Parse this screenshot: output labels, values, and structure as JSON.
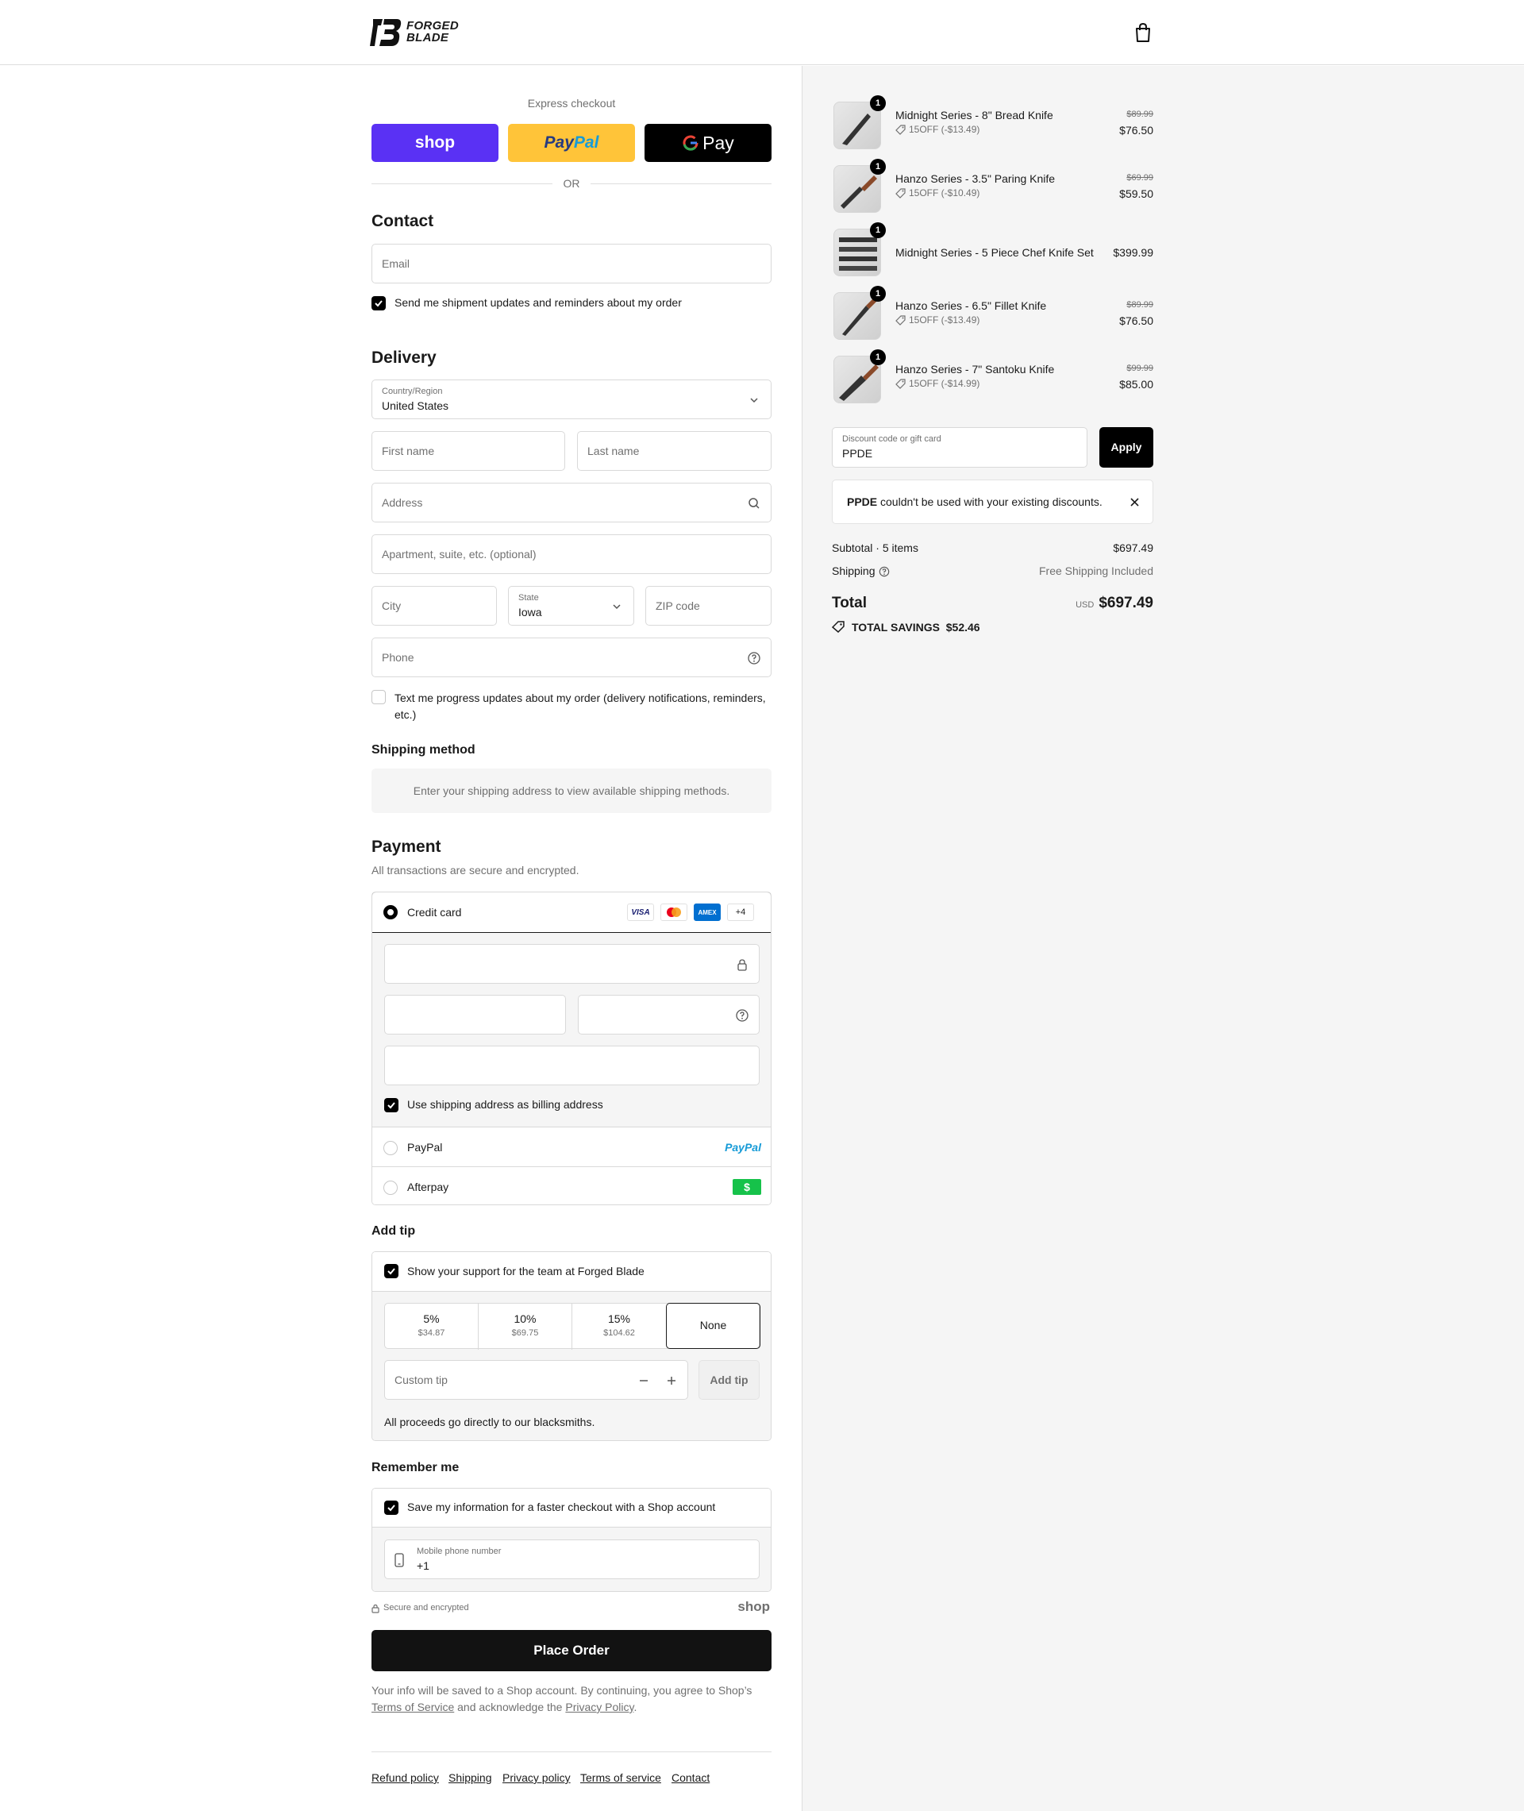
{
  "brand": {
    "line1": "FORGED",
    "line2": "BLADE"
  },
  "express": {
    "title": "Express checkout",
    "shop": "shop",
    "paypal_a": "Pay",
    "paypal_b": "Pal",
    "gpay": "Pay",
    "or": "OR"
  },
  "contact": {
    "title": "Contact",
    "email_placeholder": "Email",
    "updates_label": "Send me shipment updates and reminders about my order"
  },
  "delivery": {
    "title": "Delivery",
    "country_label": "Country/Region",
    "country_value": "United States",
    "first_name": "First name",
    "last_name": "Last name",
    "address": "Address",
    "apartment": "Apartment, suite, etc. (optional)",
    "city": "City",
    "state_label": "State",
    "state_value": "Iowa",
    "zip": "ZIP code",
    "phone": "Phone",
    "sms_label": "Text me progress updates about my order (delivery notifications, reminders, etc.)"
  },
  "shipping_method": {
    "title": "Shipping method",
    "notice": "Enter your shipping address to view available shipping methods."
  },
  "payment": {
    "title": "Payment",
    "subtitle": "All transactions are secure and encrypted.",
    "credit_card": "Credit card",
    "badges": {
      "visa": "VISA",
      "amex": "AMEX",
      "more": "+4"
    },
    "billing_label": "Use shipping address as billing address",
    "paypal": "PayPal",
    "paypal_logo": "PayPal",
    "afterpay": "Afterpay"
  },
  "tip": {
    "title": "Add tip",
    "support_label": "Show your support for the team at Forged Blade",
    "options": [
      {
        "pct": "5%",
        "amt": "$34.87"
      },
      {
        "pct": "10%",
        "amt": "$69.75"
      },
      {
        "pct": "15%",
        "amt": "$104.62"
      },
      {
        "pct": "None",
        "amt": ""
      }
    ],
    "custom_placeholder": "Custom tip",
    "add_button": "Add tip",
    "note": "All proceeds go directly to our blacksmiths."
  },
  "remember": {
    "title": "Remember me",
    "save_label": "Save my information for a faster checkout with a Shop account",
    "mobile_label": "Mobile phone number",
    "mobile_value": "+1",
    "secure": "Secure and encrypted",
    "shop_logo": "shop"
  },
  "place_order": "Place Order",
  "legal": {
    "text1": "Your info will be saved to a Shop account. By continuing, you agree to Shop’s",
    "terms": "Terms of Service",
    "text2": "and acknowledge the",
    "privacy": "Privacy Policy",
    "text3": "."
  },
  "footer_links": [
    "Refund policy",
    "Shipping",
    "Privacy policy",
    "Terms of service",
    "Contact"
  ],
  "cart": {
    "items": [
      {
        "qty": "1",
        "name": "Midnight Series - 8\" Bread Knife",
        "discount": "15OFF (-$13.49)",
        "old_price": "$89.99",
        "price": "$76.50"
      },
      {
        "qty": "1",
        "name": "Hanzo Series - 3.5\" Paring Knife",
        "discount": "15OFF (-$10.49)",
        "old_price": "$69.99",
        "price": "$59.50"
      },
      {
        "qty": "1",
        "name": "Midnight Series - 5 Piece Chef Knife Set",
        "discount": "",
        "old_price": "",
        "price": "$399.99"
      },
      {
        "qty": "1",
        "name": "Hanzo Series - 6.5\" Fillet Knife",
        "discount": "15OFF (-$13.49)",
        "old_price": "$89.99",
        "price": "$76.50"
      },
      {
        "qty": "1",
        "name": "Hanzo Series - 7\" Santoku Knife",
        "discount": "15OFF (-$14.99)",
        "old_price": "$99.99",
        "price": "$85.00"
      }
    ],
    "discount_label": "Discount code or gift card",
    "discount_value": "PPDE",
    "apply": "Apply",
    "error_code": "PPDE",
    "error_text": "couldn't be used with your existing discounts.",
    "subtotal_label": "Subtotal · 5 items",
    "subtotal_value": "$697.49",
    "shipping_label": "Shipping",
    "shipping_value": "Free Shipping Included",
    "total_label": "Total",
    "currency": "USD",
    "total_value": "$697.49",
    "savings_label": "TOTAL SAVINGS",
    "savings_value": "$52.46"
  },
  "colors": {
    "shop": "#5a31f4",
    "paypal": "#ffc439",
    "gpay": "#000000",
    "afterpay": "#16c24a"
  }
}
